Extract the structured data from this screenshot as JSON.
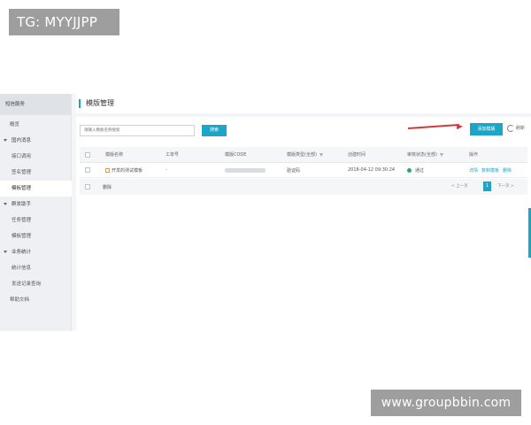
{
  "watermark_top": "TG: MYYJJPP",
  "watermark_bottom": "www.groupbbin.com",
  "sidebar": {
    "title": "短信服务",
    "items": [
      {
        "label": "概览",
        "kind": "top"
      },
      {
        "label": "国内消息",
        "kind": "group"
      },
      {
        "label": "接口调用",
        "kind": "sub"
      },
      {
        "label": "签名管理",
        "kind": "sub"
      },
      {
        "label": "模板管理",
        "kind": "sub",
        "active": true
      },
      {
        "label": "群发助手",
        "kind": "group"
      },
      {
        "label": "任务管理",
        "kind": "sub"
      },
      {
        "label": "模板管理",
        "kind": "sub"
      },
      {
        "label": "业务统计",
        "kind": "group"
      },
      {
        "label": "统计信息",
        "kind": "sub"
      },
      {
        "label": "发送记录查询",
        "kind": "sub"
      },
      {
        "label": "帮助文档",
        "kind": "top"
      }
    ]
  },
  "header": {
    "title": "模版管理"
  },
  "toolbar": {
    "search_placeholder": "请输入模板名称搜索",
    "search_label": "搜索",
    "add_label": "添加模版",
    "refresh_label": "刷新"
  },
  "table": {
    "columns": [
      "模版名称",
      "工单号",
      "模版CODE",
      "模版类型(全部)",
      "创建时间",
      "审核状态(全部)",
      "操作"
    ],
    "rows": [
      {
        "name": "开发的测试模板",
        "ticket": "-",
        "code": "",
        "type": "验证码",
        "created": "2018-04-12 09:30:24",
        "status": "通过",
        "ops": [
          "详情",
          "复制模板",
          "删除"
        ]
      }
    ],
    "footer_label": "删除",
    "pager": {
      "prev": "< 上一页",
      "current": "1",
      "next": "下一页 >"
    }
  },
  "colors": {
    "accent": "#1ba5c7",
    "arrow": "#d23a3a",
    "status_ok": "#2aa866"
  }
}
